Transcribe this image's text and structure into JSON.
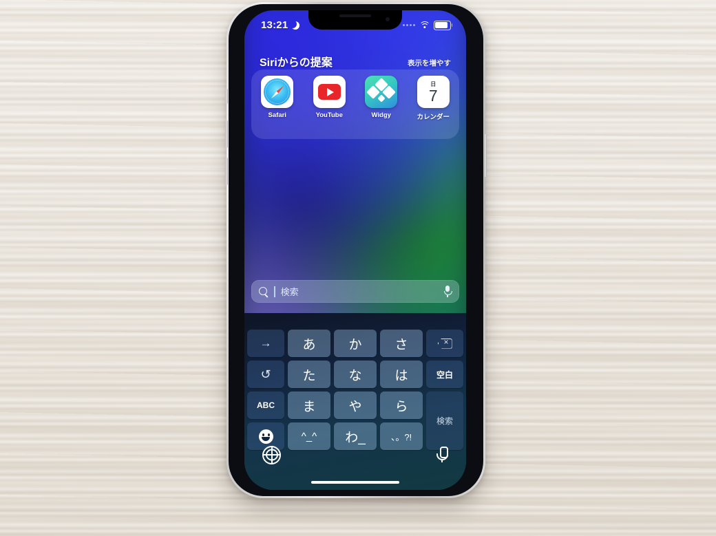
{
  "device": {
    "name": "iPhone",
    "orientation": "portrait"
  },
  "status_bar": {
    "time": "13:21",
    "dnd_icon": "crescent-moon-icon",
    "signal_icon": "signal-dots-icon",
    "wifi_icon": "wifi-icon",
    "battery_icon": "battery-full-icon"
  },
  "siri_suggestions": {
    "title": "Siriからの提案",
    "show_more_label": "表示を増やす",
    "apps": [
      {
        "label": "Safari",
        "icon": "safari-icon"
      },
      {
        "label": "YouTube",
        "icon": "youtube-icon"
      },
      {
        "label": "Widgy",
        "icon": "widgy-icon"
      },
      {
        "label": "カレンダー",
        "icon": "calendar-icon",
        "day_of_week": "日",
        "day_number": "7"
      }
    ]
  },
  "search": {
    "placeholder": "検索",
    "value": "",
    "search_icon": "magnifier-icon",
    "mic_icon": "microphone-icon"
  },
  "keyboard": {
    "layout": "japanese-kana-12key",
    "rows": [
      [
        {
          "label": "→",
          "name": "cursor-right-key",
          "type": "fn"
        },
        {
          "label": "あ",
          "name": "kana-a-key",
          "type": "char"
        },
        {
          "label": "か",
          "name": "kana-ka-key",
          "type": "char"
        },
        {
          "label": "さ",
          "name": "kana-sa-key",
          "type": "char"
        },
        {
          "label": "",
          "name": "delete-key",
          "type": "fn-icon",
          "icon": "delete-backward-icon"
        }
      ],
      [
        {
          "label": "↺",
          "name": "undo-key",
          "type": "fn"
        },
        {
          "label": "た",
          "name": "kana-ta-key",
          "type": "char"
        },
        {
          "label": "な",
          "name": "kana-na-key",
          "type": "char"
        },
        {
          "label": "は",
          "name": "kana-ha-key",
          "type": "char"
        },
        {
          "label": "空白",
          "name": "space-key",
          "type": "fn-small"
        }
      ],
      [
        {
          "label": "ABC",
          "name": "abc-key",
          "type": "fn-small"
        },
        {
          "label": "ま",
          "name": "kana-ma-key",
          "type": "char"
        },
        {
          "label": "や",
          "name": "kana-ya-key",
          "type": "char"
        },
        {
          "label": "ら",
          "name": "kana-ra-key",
          "type": "char"
        },
        {
          "label": "検索",
          "name": "search-return-key",
          "type": "return"
        }
      ],
      [
        {
          "label": "",
          "name": "emoji-key",
          "type": "fn-icon",
          "icon": "emoji-smiley-icon"
        },
        {
          "label": "^_^",
          "name": "kaomoji-key",
          "type": "char-mid"
        },
        {
          "label": "わ_",
          "name": "kana-wa-key",
          "type": "char"
        },
        {
          "label": "、。?!",
          "name": "punctuation-key",
          "type": "char-tiny"
        }
      ]
    ],
    "bottom_bar": {
      "globe_icon": "globe-language-icon",
      "dictation_icon": "microphone-dictation-icon"
    }
  },
  "home_indicator": "home-indicator-bar",
  "colors": {
    "wallpaper_blue": "#2622e0",
    "key_face": "rgba(150,190,225,0.40)",
    "key_function": "rgba(60,92,140,0.42)",
    "youtube_red": "#e8262a",
    "widgy_teal": "#36c9c0"
  }
}
